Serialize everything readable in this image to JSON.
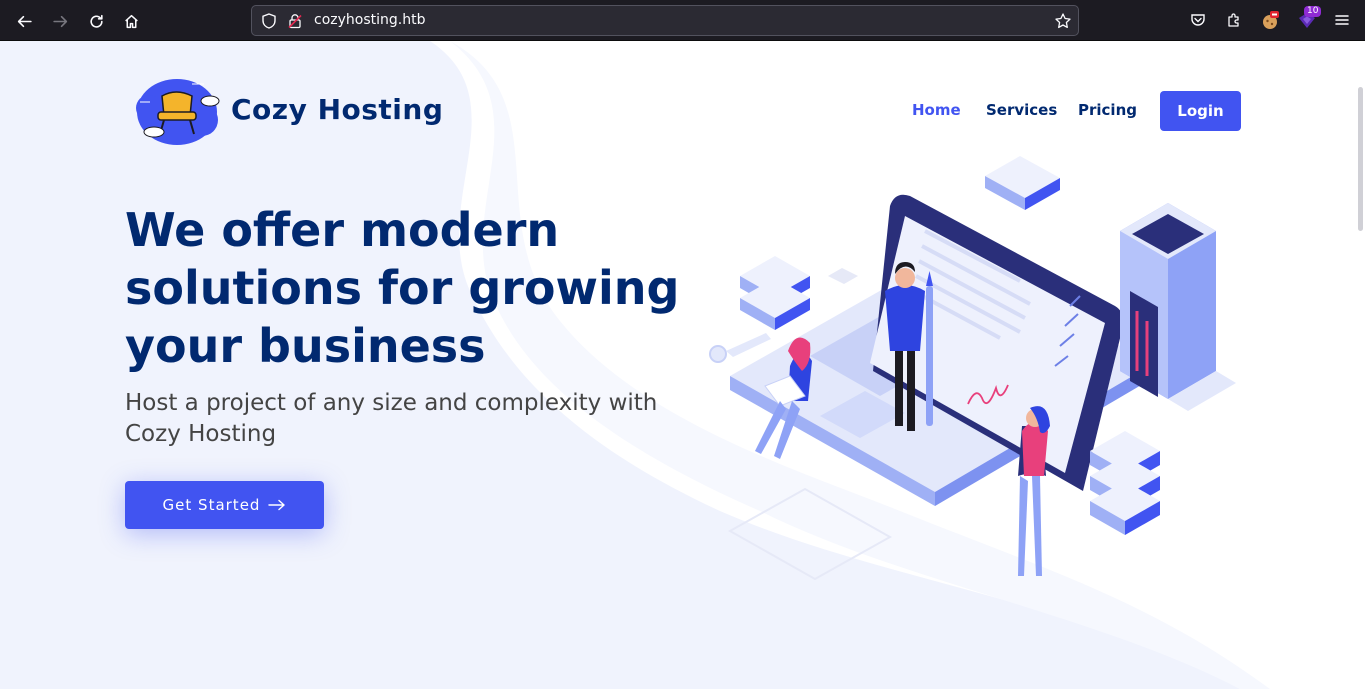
{
  "browser": {
    "url": "cozyhosting.htb",
    "extension_badge": "10"
  },
  "site": {
    "brand": "Cozy Hosting",
    "nav": {
      "home": "Home",
      "services": "Services",
      "pricing": "Pricing",
      "login": "Login"
    },
    "hero": {
      "headline_line1": "We offer modern",
      "headline_line2": "solutions for growing",
      "headline_line3": "your business",
      "subline_line1": "Host a project of any size and complexity with",
      "subline_line2": "Cozy Hosting",
      "cta": "Get Started"
    }
  },
  "colors": {
    "accent": "#4154f1",
    "heading": "#012970",
    "body_text": "#444444",
    "hero_bg": "#f0f3fd",
    "chrome_bg": "#1c1b22"
  }
}
